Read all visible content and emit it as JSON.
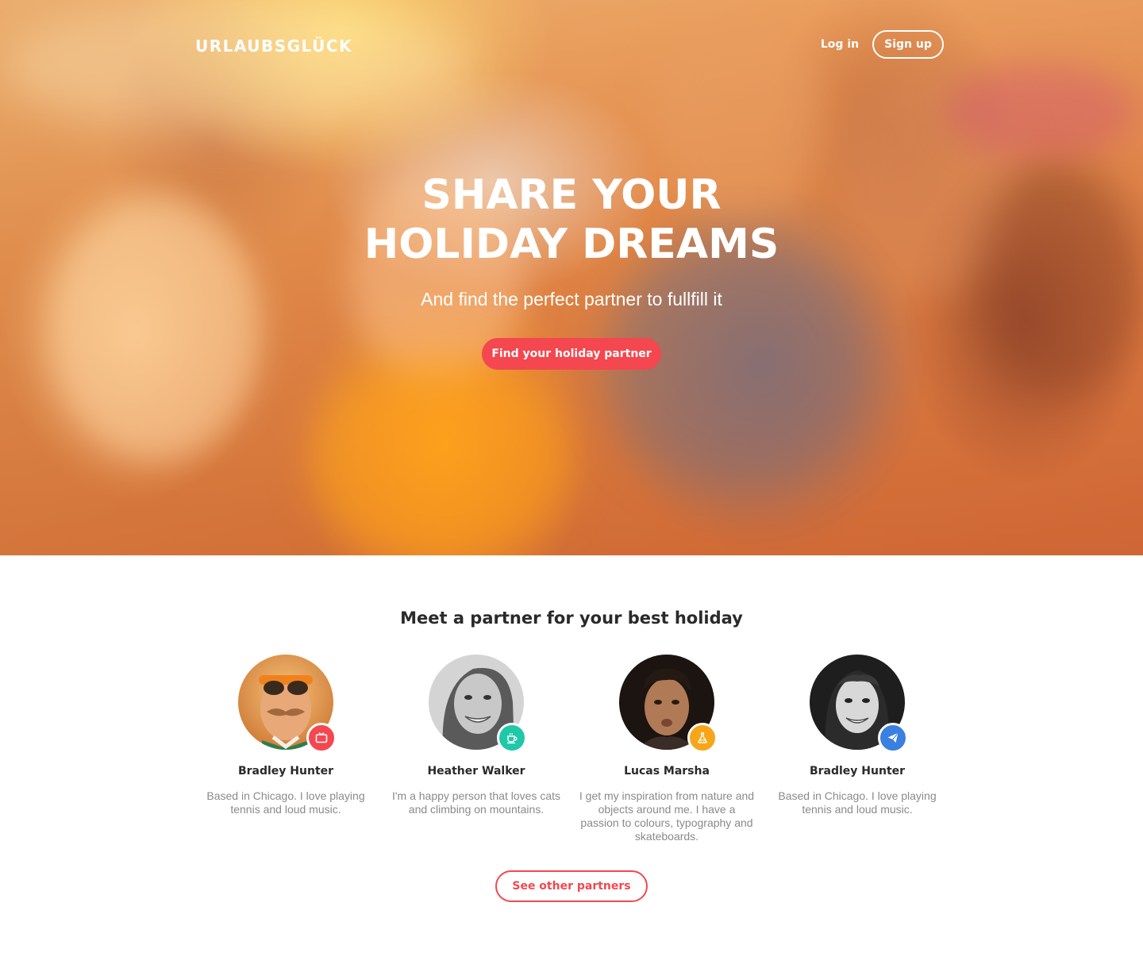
{
  "header": {
    "brand": "URLAUBSGLÜCK",
    "login_label": "Log in",
    "signup_label": "Sign up"
  },
  "hero": {
    "title_line1": "SHARE YOUR",
    "title_line2": "HOLIDAY DREAMS",
    "subtitle": "And find the perfect partner to fullfill it",
    "cta_label": "Find your holiday partner",
    "image_subject": "group-of-friends-laughing"
  },
  "partners": {
    "title": "Meet a partner for your best holiday",
    "items": [
      {
        "name": "Bradley Hunter",
        "bio": "Based in Chicago. I love playing tennis and loud music.",
        "badge_icon": "tv-icon",
        "badge_color": "#f4474f",
        "avatar_tone": "color"
      },
      {
        "name": "Heather Walker",
        "bio": "I'm a happy person that loves cats and climbing on mountains.",
        "badge_icon": "coffee-cup-icon",
        "badge_color": "#1fc8a8",
        "avatar_tone": "grayscale"
      },
      {
        "name": "Lucas Marsha",
        "bio": "I get my inspiration from nature and objects around me. I have a passion to colours, typography and skateboards.",
        "badge_icon": "flask-icon",
        "badge_color": "#f7a61a",
        "avatar_tone": "dark"
      },
      {
        "name": "Bradley Hunter",
        "bio": "Based in Chicago. I love playing tennis and loud music.",
        "badge_icon": "paper-plane-icon",
        "badge_color": "#3b7fe0",
        "avatar_tone": "grayscale"
      }
    ],
    "more_label": "See other partners"
  },
  "colors": {
    "accent": "#f4474f",
    "text_dark": "#2a2a2a",
    "text_muted": "#8a8a8a"
  }
}
